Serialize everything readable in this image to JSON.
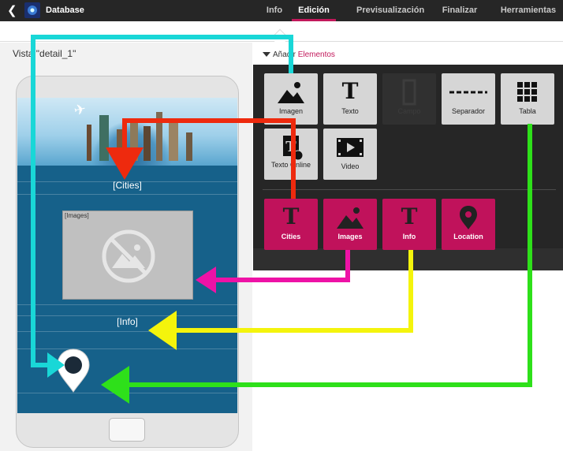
{
  "header": {
    "app_title": "Database",
    "back_icon": "chevron-left-icon",
    "tabs": [
      {
        "label": "Info"
      },
      {
        "label": "Edición"
      },
      {
        "label": "Previsualización"
      },
      {
        "label": "Finalizar"
      },
      {
        "label": "Herramientas"
      }
    ],
    "active_tab": "Edición"
  },
  "view": {
    "label": "Vista \"detail_1\"",
    "add_prefix": "Añadir",
    "add_link": "Elementos"
  },
  "phone_screen": {
    "cities_label": "[Cities]",
    "images_placeholder": "[Images]",
    "info_label": "[Info]",
    "location_icon": "map-pin-icon"
  },
  "elements": {
    "basic": [
      {
        "label": "Imagen",
        "icon": "image-icon"
      },
      {
        "label": "Texto",
        "icon": "text-icon"
      },
      {
        "label": "Campo",
        "icon": "field-icon",
        "disabled": true
      },
      {
        "label": "Separador",
        "icon": "separator-icon"
      },
      {
        "label": "Tabla",
        "icon": "grid-icon"
      },
      {
        "label": "Texto Online",
        "icon": "online-text-icon"
      },
      {
        "label": "Video",
        "icon": "film-icon"
      }
    ],
    "fields": [
      {
        "label": "Cities",
        "icon": "text-icon"
      },
      {
        "label": "Images",
        "icon": "image-icon"
      },
      {
        "label": "Info",
        "icon": "text-icon"
      },
      {
        "label": "Location",
        "icon": "map-pin-icon"
      }
    ]
  },
  "colors": {
    "accent": "#c2185b",
    "topbar": "#262626",
    "screen": "#16618a",
    "arrow_cyan": "#19d7d7",
    "arrow_red": "#ee2a0e",
    "arrow_magenta": "#ee12a6",
    "arrow_yellow": "#f4f40c",
    "arrow_green": "#2ee01a"
  }
}
